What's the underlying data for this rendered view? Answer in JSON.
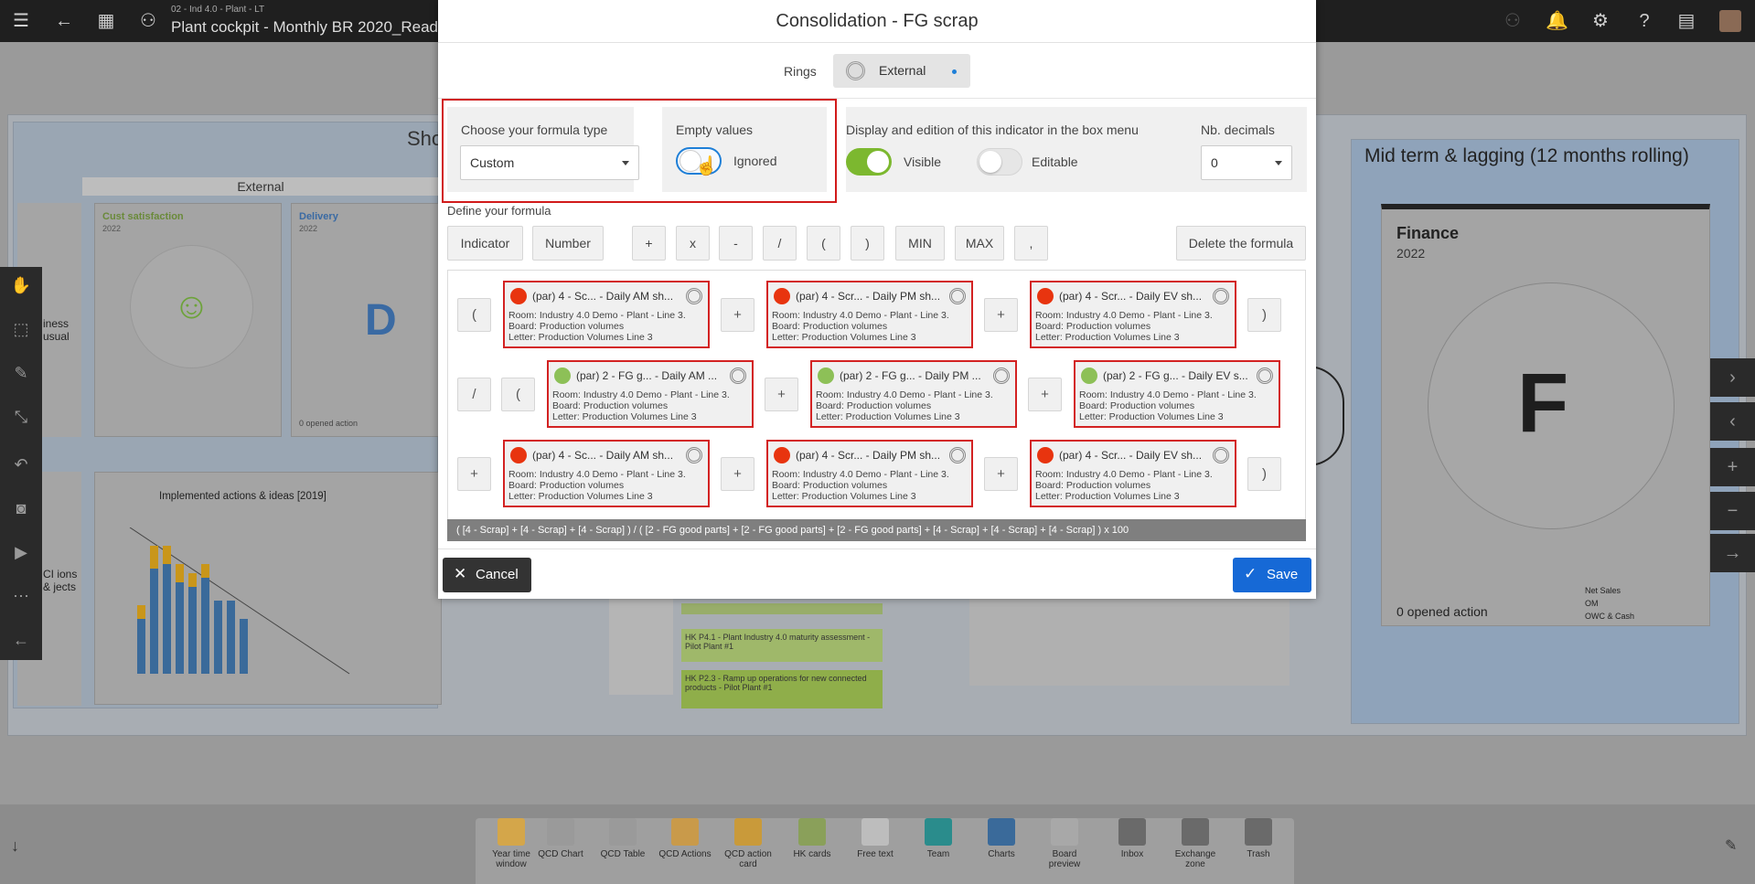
{
  "topbar": {
    "subtitle": "02 - Ind 4.0 - Plant - LT",
    "title": "Plant cockpit - Monthly BR 2020_Readytous"
  },
  "board": {
    "panel_left_title": "Sho",
    "external_tag": "External",
    "cust_title": "Cust satisfaction",
    "cust_year": "2022",
    "delivery_title": "Delivery",
    "delivery_year": "2022",
    "delivery_letter": "D",
    "opened_action": "0 opened action",
    "business_text": "iness usual",
    "ci_text": "CI ions & jects",
    "chart_title": "Implemented actions & ideas [2019]",
    "mid_title": "Mid term & lagging (12 months rolling)",
    "finance_title": "Finance",
    "finance_year": "2022",
    "finance_letter": "F",
    "finance_opened": "0 opened action",
    "kpi_1": "Net Sales",
    "kpi_2": "OM",
    "kpi_3": "OWC & Cash",
    "hk_card_1": "HK P4.1 - Plant Industry 4.0 maturity assessment - Pilot Plant #1",
    "hk_card_2": "HK P2.3 - Ramp up operations for new connected products - Pilot Plant #1"
  },
  "shelf": [
    {
      "label": "Year time window",
      "color": "#d4a64a"
    },
    {
      "label": "QCD Chart",
      "color": "#9a9a9a"
    },
    {
      "label": "QCD Table",
      "color": "#9a9a9a"
    },
    {
      "label": "QCD Actions",
      "color": "#c99a4a"
    },
    {
      "label": "QCD action card",
      "color": "#c99a3a"
    },
    {
      "label": "HK cards",
      "color": "#8aa05a"
    },
    {
      "label": "Free text",
      "color": "#bdbdbd"
    },
    {
      "label": "Team",
      "color": "#2a8c8c"
    },
    {
      "label": "Charts",
      "color": "#3a6a9a"
    },
    {
      "label": "Board preview",
      "color": "#a8a8a8"
    },
    {
      "label": "Inbox",
      "color": "#6a6a6a"
    },
    {
      "label": "Exchange zone",
      "color": "#6a6a6a"
    },
    {
      "label": "Trash",
      "color": "#6a6a6a"
    }
  ],
  "modal": {
    "title": "Consolidation - FG scrap",
    "rings_label": "Rings",
    "rings_value": "External",
    "formula_type_label": "Choose your formula type",
    "formula_type_value": "Custom",
    "empty_values_label": "Empty values",
    "empty_values_state": "Ignored",
    "display_label": "Display and edition of this indicator in the box menu",
    "visible_label": "Visible",
    "editable_label": "Editable",
    "decimals_label": "Nb. decimals",
    "decimals_value": "0",
    "define_label": "Define your formula",
    "buttons": {
      "indicator": "Indicator",
      "number": "Number",
      "plus": "+",
      "times": "x",
      "minus": "-",
      "divide": "/",
      "lparen": "(",
      "rparen": ")",
      "min": "MIN",
      "max": "MAX",
      "comma": ",",
      "delete": "Delete the formula"
    },
    "ops": {
      "lparen": "(",
      "rparen": ")",
      "plus": "+",
      "divide": "/"
    },
    "indicators": [
      {
        "head": "(par)  4 - Sc...     - Daily    AM sh...",
        "status": "red",
        "room": "Room: Industry 4.0 Demo - Plant - Line 3.",
        "board": "Board: Production volumes",
        "letter": "Letter: Production Volumes Line 3"
      },
      {
        "head": "(par)  4 - Scr...    - Daily    PM sh...",
        "status": "red",
        "room": "Room: Industry 4.0 Demo - Plant - Line 3.",
        "board": "Board: Production volumes",
        "letter": "Letter: Production Volumes Line 3"
      },
      {
        "head": "(par)  4 - Scr...    - Daily    EV sh...",
        "status": "red",
        "room": "Room: Industry 4.0 Demo - Plant - Line 3.",
        "board": "Board: Production volumes",
        "letter": "Letter: Production Volumes Line 3"
      },
      {
        "head": "(par)  2 - FG g...    - Daily    AM ...",
        "status": "green",
        "room": "Room: Industry 4.0 Demo - Plant - Line 3.",
        "board": "Board: Production volumes",
        "letter": "Letter: Production Volumes Line 3"
      },
      {
        "head": "(par)  2 - FG g...    - Daily    PM ...",
        "status": "green",
        "room": "Room: Industry 4.0 Demo - Plant - Line 3.",
        "board": "Board: Production volumes",
        "letter": "Letter: Production Volumes Line 3"
      },
      {
        "head": "(par)  2 - FG g...    - Daily    EV s...",
        "status": "green",
        "room": "Room: Industry 4.0 Demo - Plant - Line 3.",
        "board": "Board: Production volumes",
        "letter": "Letter: Production Volumes Line 3"
      },
      {
        "head": "(par)  4 - Sc...     - Daily    AM sh...",
        "status": "red",
        "room": "Room: Industry 4.0 Demo - Plant - Line 3.",
        "board": "Board: Production volumes",
        "letter": "Letter: Production Volumes Line 3"
      },
      {
        "head": "(par)  4 - Scr...    - Daily    PM sh...",
        "status": "red",
        "room": "Room: Industry 4.0 Demo - Plant - Line 3.",
        "board": "Board: Production volumes",
        "letter": "Letter: Production Volumes Line 3"
      },
      {
        "head": "(par)  4 - Scr...    - Daily    EV sh...",
        "status": "red",
        "room": "Room: Industry 4.0 Demo - Plant - Line 3.",
        "board": "Board: Production volumes",
        "letter": "Letter: Production Volumes Line 3"
      }
    ],
    "formula_text": "( [4 - Scrap] + [4 - Scrap] + [4 - Scrap] ) / ( [2 - FG good parts] + [2 - FG good parts] + [2 - FG good parts] + [4 - Scrap] + [4 - Scrap] + [4 - Scrap] ) x 100",
    "cancel": "Cancel",
    "save": "Save"
  },
  "colors": {
    "red_status": "#e8340f",
    "green_status": "#8dc057",
    "toggle_on": "#7cb82f",
    "primary": "#1669d6",
    "highlight_frame": "#d11a1a"
  }
}
